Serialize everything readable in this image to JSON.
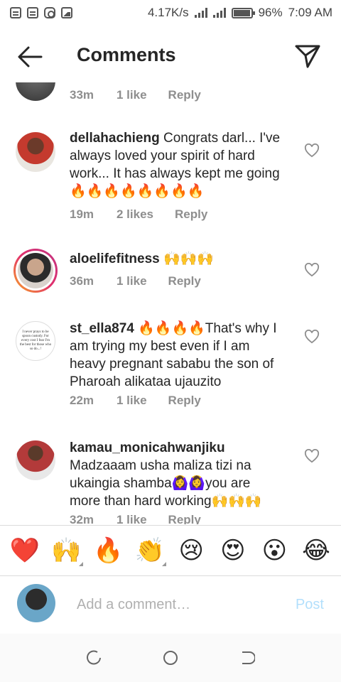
{
  "status_bar": {
    "speed": "4.17K/s",
    "battery": "96%",
    "time": "7:09 AM",
    "battery_level": 0.96
  },
  "header": {
    "title": "Comments"
  },
  "comments": [
    {
      "user": "",
      "text": "",
      "time": "33m",
      "likes": "1 like",
      "reply": "Reply"
    },
    {
      "user": "dellahachieng",
      "text": " Congrats darl... I've always loved your spirit of hard work... It has always kept me going🔥🔥🔥🔥🔥🔥🔥🔥",
      "time": "19m",
      "likes": "2 likes",
      "reply": "Reply"
    },
    {
      "user": "aloelifefitness",
      "text": " 🙌🙌🙌",
      "time": "36m",
      "likes": "1 like",
      "reply": "Reply"
    },
    {
      "user": "st_ella874",
      "text": " 🔥🔥🔥🔥That's why I am trying my best even if I am heavy pregnant sababu the son of Pharoah alikataa ujauzito",
      "time": "22m",
      "likes": "1 like",
      "reply": "Reply"
    },
    {
      "user": "kamau_monicahwanjiku",
      "text": " Madzaaam usha maliza tizi na ukaingia shamba🙆‍♀️🙆‍♀️you are more than hard working🙌🙌🙌",
      "time": "32m",
      "likes": "1 like",
      "reply": "Reply"
    }
  ],
  "avatar_texts": {
    "st_ella874": "I never prays to be spoon custody. For every cost I fear I'm the best for those who so do...!"
  },
  "emoji_bar": [
    "❤️",
    "🙌",
    "🔥",
    "👏",
    "😢",
    "😍",
    "😮",
    "😂"
  ],
  "add_comment": {
    "placeholder": "Add a comment…",
    "post_label": "Post"
  },
  "colors": {
    "meta": "#8e8e8e",
    "post_disabled": "#b2dffc",
    "heart": "#ed1c24"
  }
}
